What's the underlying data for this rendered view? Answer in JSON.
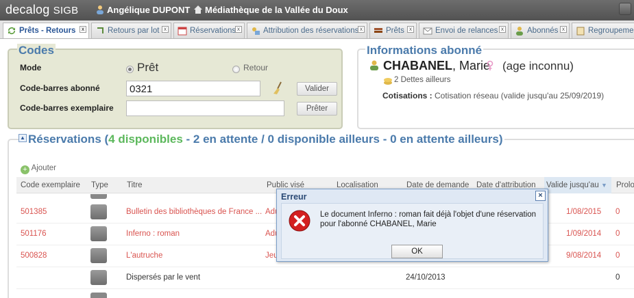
{
  "header": {
    "brand": "decalog",
    "brand_sub": "SIGB",
    "user": "Angélique DUPONT",
    "library": "Médiathèque de la Vallée du Doux"
  },
  "tabs": [
    {
      "label": "Prêts - Retours",
      "active": true
    },
    {
      "label": "Retours par lot"
    },
    {
      "label": "Réservations"
    },
    {
      "label": "Attribution des réservations"
    },
    {
      "label": "Prêts"
    },
    {
      "label": "Envoi de relances"
    },
    {
      "label": "Abonnés"
    },
    {
      "label": "Regroupement"
    }
  ],
  "codes": {
    "title": "Codes",
    "mode_label": "Mode",
    "mode_pret": "Prêt",
    "mode_retour": "Retour",
    "abonne_label": "Code-barres abonné",
    "abonne_value": "0321",
    "valider": "Valider",
    "exemplaire_label": "Code-barres exemplaire",
    "exemplaire_value": "",
    "preter": "Prêter"
  },
  "info": {
    "title": "Informations abonné",
    "name_last": "CHABANEL",
    "name_first": ", Marie",
    "age": "(age inconnu)",
    "dettes": "2 Dettes ailleurs",
    "cotisations_label": "Cotisations :",
    "cotisations_value": "Cotisation réseau (valide jusqu'au 25/09/2019)"
  },
  "reservations": {
    "title_prefix": "Réservations (",
    "disponibles": "4 disponibles",
    "title_rest": " - 2 en attente / 0 disponible ailleurs - 0 en attente ailleurs)",
    "ajouter": "Ajouter",
    "columns": [
      "Code exemplaire",
      "Type",
      "Titre",
      "Public visé",
      "Localisation",
      "Date de demande",
      "Date d'attribution",
      "Valide jusqu'au",
      "Prolo"
    ],
    "rows": [
      {
        "code": "501385",
        "titre": "Bulletin des bibliothèques de France ...",
        "public": "Adu",
        "demande": "",
        "valide": "1/08/2015",
        "prolo": "0",
        "red": true
      },
      {
        "code": "501176",
        "titre": "Inferno : roman",
        "public": "Adu",
        "demande": "",
        "valide": "1/09/2014",
        "prolo": "0",
        "red": true
      },
      {
        "code": "500828",
        "titre": "L'autruche",
        "public": "Jeu",
        "demande": "",
        "valide": "9/08/2014",
        "prolo": "0",
        "red": true
      },
      {
        "code": "",
        "titre": "Dispersés par le vent",
        "public": "",
        "demande": "24/10/2013",
        "valide": "",
        "prolo": "0",
        "red": false
      }
    ]
  },
  "dialog": {
    "title": "Erreur",
    "message": "Le document Inferno : roman fait déjà l'objet d'une réservation pour l'abonné CHABANEL, Marie",
    "ok": "OK"
  },
  "colors": {
    "accent": "#4a7aab",
    "green": "#5cb85c",
    "red": "#d9534f"
  }
}
